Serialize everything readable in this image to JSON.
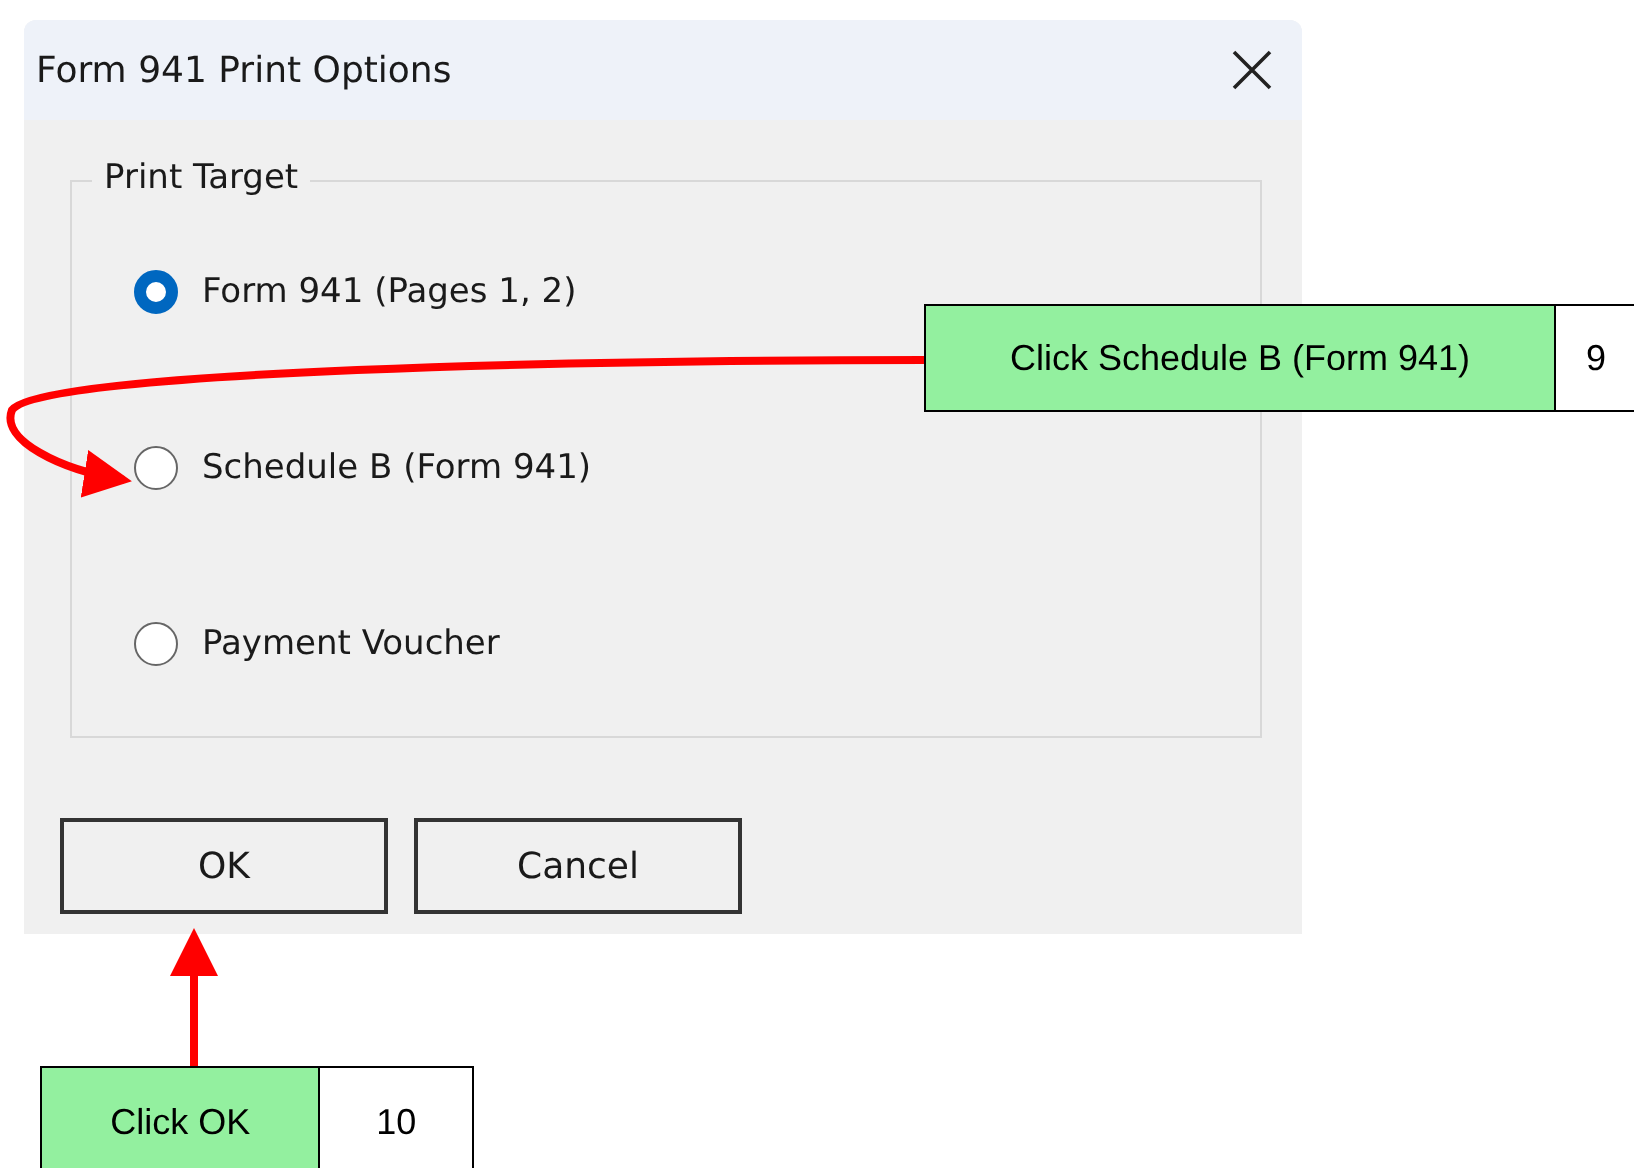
{
  "window": {
    "title": "Form 941 Print Options"
  },
  "group": {
    "title": "Print Target",
    "options": [
      {
        "label": "Form 941 (Pages 1, 2)",
        "selected": true
      },
      {
        "label": "Schedule B (Form 941)",
        "selected": false
      },
      {
        "label": "Payment Voucher",
        "selected": false
      }
    ]
  },
  "buttons": [
    "OK",
    "Cancel"
  ],
  "callouts": [
    {
      "text": "Click Schedule B (Form 941)",
      "step": "9"
    },
    {
      "text": "Click OK",
      "step": "10"
    }
  ]
}
